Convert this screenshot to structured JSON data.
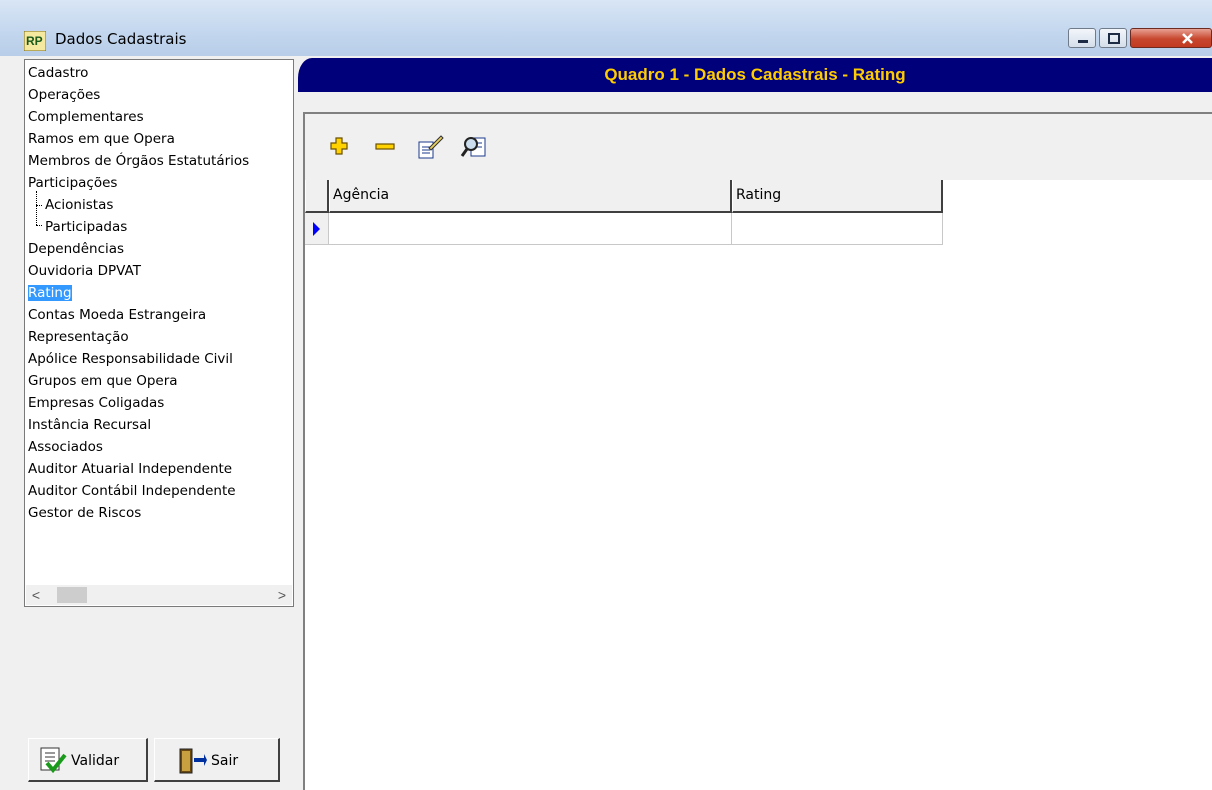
{
  "window": {
    "title": "Dados Cadastrais"
  },
  "tree": {
    "items": [
      {
        "label": "Cadastro"
      },
      {
        "label": "Operações"
      },
      {
        "label": "Complementares"
      },
      {
        "label": "Ramos em que Opera"
      },
      {
        "label": "Membros de Órgãos Estatutários"
      },
      {
        "label": "Participações"
      },
      {
        "label": "Acionistas"
      },
      {
        "label": "Participadas"
      },
      {
        "label": "Dependências"
      },
      {
        "label": "Ouvidoria DPVAT"
      },
      {
        "label": "Rating",
        "selected": true
      },
      {
        "label": "Contas Moeda Estrangeira"
      },
      {
        "label": "Representação"
      },
      {
        "label": "Apólice Responsabilidade Civil"
      },
      {
        "label": "Grupos em que Opera"
      },
      {
        "label": "Empresas Coligadas"
      },
      {
        "label": "Instância Recursal"
      },
      {
        "label": "Associados"
      },
      {
        "label": "Auditor Atuarial Independente"
      },
      {
        "label": "Auditor Contábil Independente"
      },
      {
        "label": "Gestor de Riscos"
      }
    ]
  },
  "buttons": {
    "validar": "Validar",
    "sair": "Sair"
  },
  "header": {
    "title": "Quadro 1 - Dados Cadastrais - Rating"
  },
  "grid": {
    "columns": [
      "Agência",
      "Rating"
    ]
  },
  "colors": {
    "header_bg": "#00007a",
    "header_text": "#ffcc00",
    "selection": "#3399ff"
  }
}
